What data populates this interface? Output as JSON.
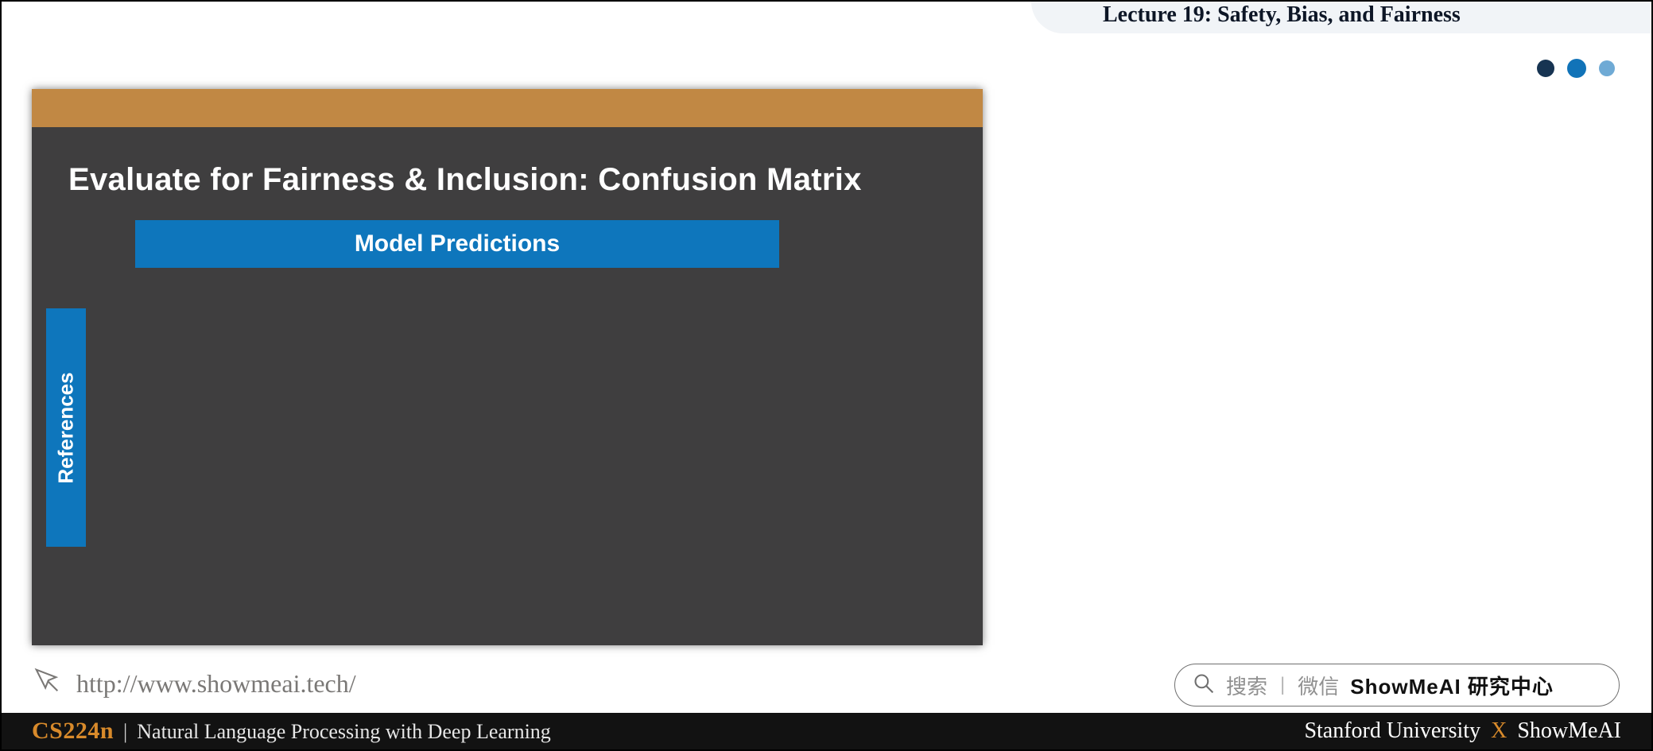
{
  "header": {
    "lecture_label": "Lecture 19: Safety, Bias, and Fairness"
  },
  "slide": {
    "title": "Evaluate for Fairness & Inclusion: Confusion Matrix",
    "columns_label": "Model Predictions",
    "rows_label": "References"
  },
  "url": "http://www.showmeai.tech/",
  "search": {
    "action": "搜索",
    "channel": "微信",
    "brand": "ShowMeAI 研究中心"
  },
  "footer": {
    "course_code": "CS224n",
    "course_name": "Natural Language Processing with Deep Learning",
    "university": "Stanford University",
    "connector": "X",
    "organization": "ShowMeAI"
  }
}
